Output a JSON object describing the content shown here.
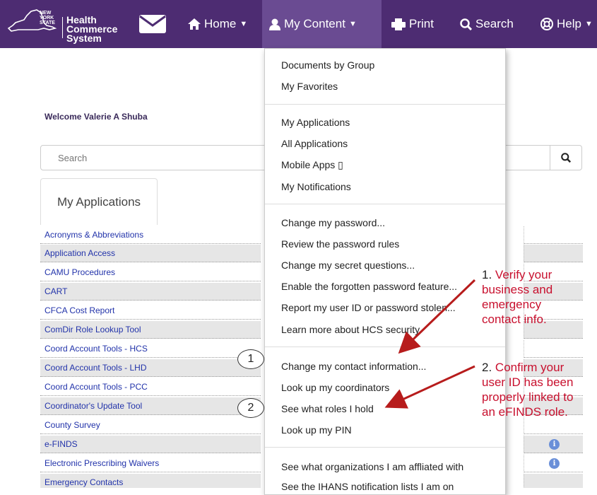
{
  "header": {
    "logo_state": [
      "NEW",
      "YORK",
      "STATE"
    ],
    "logo_system": [
      "Health",
      "Commerce",
      "System"
    ],
    "nav": {
      "mail_icon": "envelope-icon",
      "home": "Home",
      "my_content": "My Content",
      "print": "Print",
      "search": "Search",
      "help": "Help"
    },
    "bg_color": "#4d2c72"
  },
  "welcome": "Welcome Valerie A Shuba",
  "search": {
    "placeholder": "Search"
  },
  "tab": {
    "label": "My Applications"
  },
  "applications": [
    "Acronyms & Abbreviations",
    "Application Access",
    "CAMU Procedures",
    "CART",
    "CFCA Cost Report",
    "ComDir Role Lookup Tool",
    "Coord Account Tools - HCS",
    "Coord Account Tools - LHD",
    "Coord Account Tools - PCC",
    "Coordinator's Update Tool",
    "County Survey",
    "e-FINDS",
    "Electronic Prescribing Waivers",
    "Emergency Contacts"
  ],
  "dropdown": {
    "group1": [
      "Documents by Group",
      "My Favorites"
    ],
    "group2": [
      "My Applications",
      "All Applications",
      "Mobile Apps ▯",
      "My Notifications"
    ],
    "group3": [
      "Change my password...",
      "Review the password rules",
      "Change my secret questions...",
      "Enable the forgotten password feature...",
      "Report my user ID or password stolen...",
      "Learn more about HCS security"
    ],
    "group4": [
      "Change my contact information...",
      "Look up my coordinators",
      "See what roles I hold",
      "Look up my PIN"
    ],
    "group5": [
      "See what organizations I am affliated with",
      "See the IHANS notification lists I am on"
    ]
  },
  "annotations": {
    "first": {
      "number": "1.",
      "lines": [
        "Verify your",
        "business and",
        "emergency",
        "contact info."
      ]
    },
    "second": {
      "number": "2.",
      "lines": [
        "Confirm your",
        "user ID has been",
        "properly linked to",
        "an eFINDS role."
      ]
    },
    "circle1": "1",
    "circle2": "2",
    "color": "#c8102e"
  }
}
